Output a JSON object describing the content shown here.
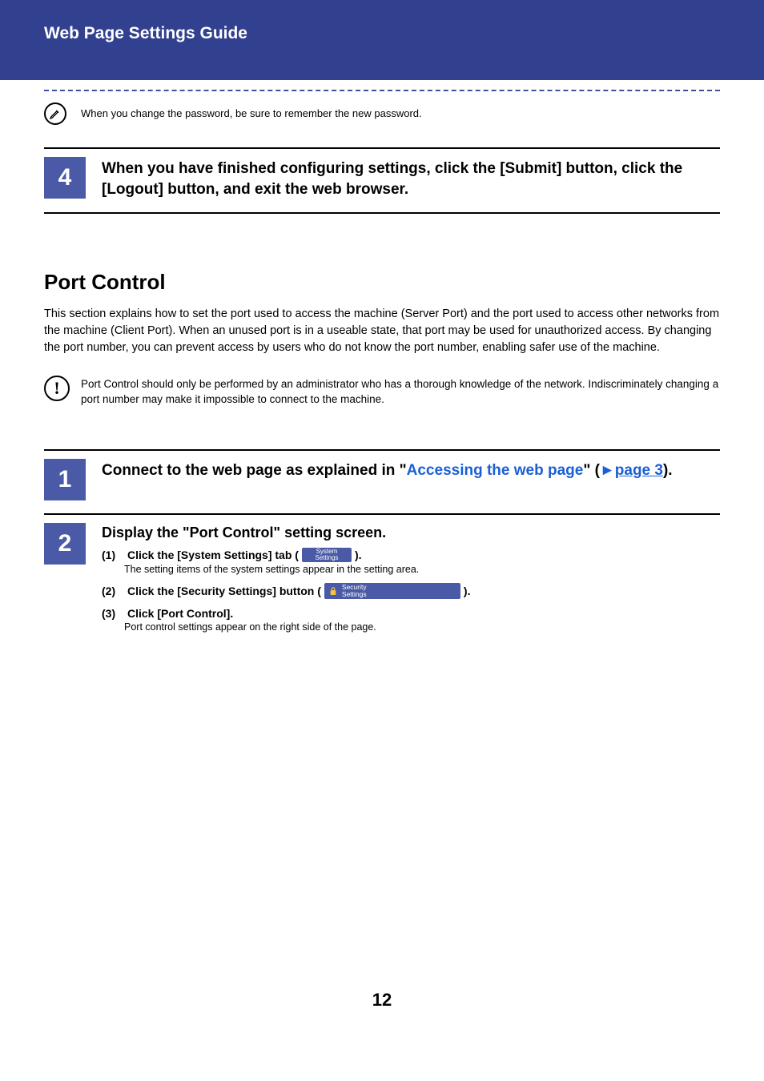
{
  "header": {
    "title": "Web Page Settings Guide"
  },
  "pencil_note": "When you change the password, be sure to remember the new password.",
  "step4": {
    "num": "4",
    "text": "When you have finished configuring settings, click the [Submit] button, click the [Logout] button, and exit the web browser."
  },
  "section": {
    "title": "Port Control",
    "para": "This section explains how to set the port used to access the machine (Server Port) and the port used to access other networks from the machine (Client Port). When an unused port is in a useable state, that port may be used for unauthorized access. By changing the port number, you can prevent access by users who do not know the port number, enabling safer use of the machine."
  },
  "caution": "Port Control should only be performed by an administrator who has a thorough knowledge of the network. Indiscriminately changing a port number may make it impossible to connect to the machine.",
  "step1": {
    "num": "1",
    "prefix": "Connect to the web page as explained in \"",
    "link1": "Accessing the web page",
    "mid": "\" (",
    "arrow": "►",
    "link2": "page 3",
    "suffix": ")."
  },
  "step2": {
    "num": "2",
    "heading": "Display the \"Port Control\" setting screen.",
    "items": [
      {
        "idx": "(1)",
        "before": "Click the [System Settings] tab (",
        "chip_line1": "System",
        "chip_line2": "Settings",
        "after": ").",
        "note": "The setting items of the system settings appear in the setting area."
      },
      {
        "idx": "(2)",
        "before": "Click the [Security Settings] button (",
        "chip_line1": "Security",
        "chip_line2": "Settings",
        "after": ")."
      },
      {
        "idx": "(3)",
        "before": "Click [Port Control].",
        "note": "Port control settings appear on the right side of the page."
      }
    ]
  },
  "page_number": "12"
}
